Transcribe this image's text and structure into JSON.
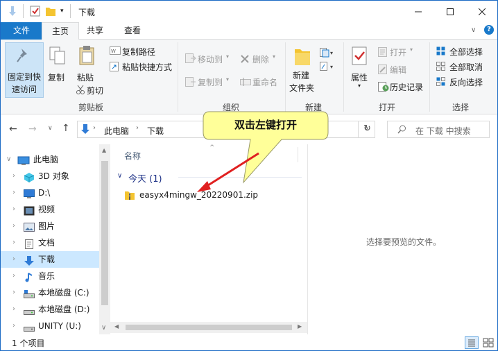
{
  "window": {
    "title": "下载"
  },
  "menu_tabs": {
    "file": "文件",
    "home": "主页",
    "share": "共享",
    "view": "查看"
  },
  "ribbon": {
    "pin_label_1": "固定到快",
    "pin_label_2": "速访问",
    "copy": "复制",
    "paste": "粘贴",
    "copy_path": "复制路径",
    "paste_shortcut": "粘贴快捷方式",
    "cut": "剪切",
    "clipboard_group": "剪贴板",
    "move_to": "移动到",
    "copy_to": "复制到",
    "delete": "删除",
    "rename": "重命名",
    "organize_group": "组织",
    "new_folder_1": "新建",
    "new_folder_2": "文件夹",
    "new_group": "新建",
    "properties": "属性",
    "open": "打开",
    "edit": "编辑",
    "history": "历史记录",
    "open_group": "打开",
    "select_all": "全部选择",
    "select_none": "全部取消",
    "invert_selection": "反向选择",
    "select_group": "选择"
  },
  "address": {
    "crumbs": [
      "此电脑",
      "下载"
    ],
    "search_placeholder": "在 下载 中搜索"
  },
  "nav": {
    "items": [
      {
        "label": "此电脑"
      },
      {
        "label": "3D 对象"
      },
      {
        "label": "D:\\"
      },
      {
        "label": "视频"
      },
      {
        "label": "图片"
      },
      {
        "label": "文档"
      },
      {
        "label": "下载"
      },
      {
        "label": "音乐"
      },
      {
        "label": "本地磁盘 (C:)"
      },
      {
        "label": "本地磁盘 (D:)"
      },
      {
        "label": "UNITY (U:)"
      }
    ]
  },
  "content": {
    "column_name": "名称",
    "group_header": "今天 (1)",
    "files": [
      {
        "name": "easyx4mingw_20220901.zip"
      }
    ]
  },
  "preview": {
    "empty_text": "选择要预览的文件。"
  },
  "status": {
    "item_count": "1 个项目"
  },
  "callout": {
    "text": "双击左键打开"
  },
  "colors": {
    "accent": "#1979ca",
    "selection": "#cce8ff",
    "callout_fill": "#ffff99",
    "arrow": "#e02020"
  }
}
